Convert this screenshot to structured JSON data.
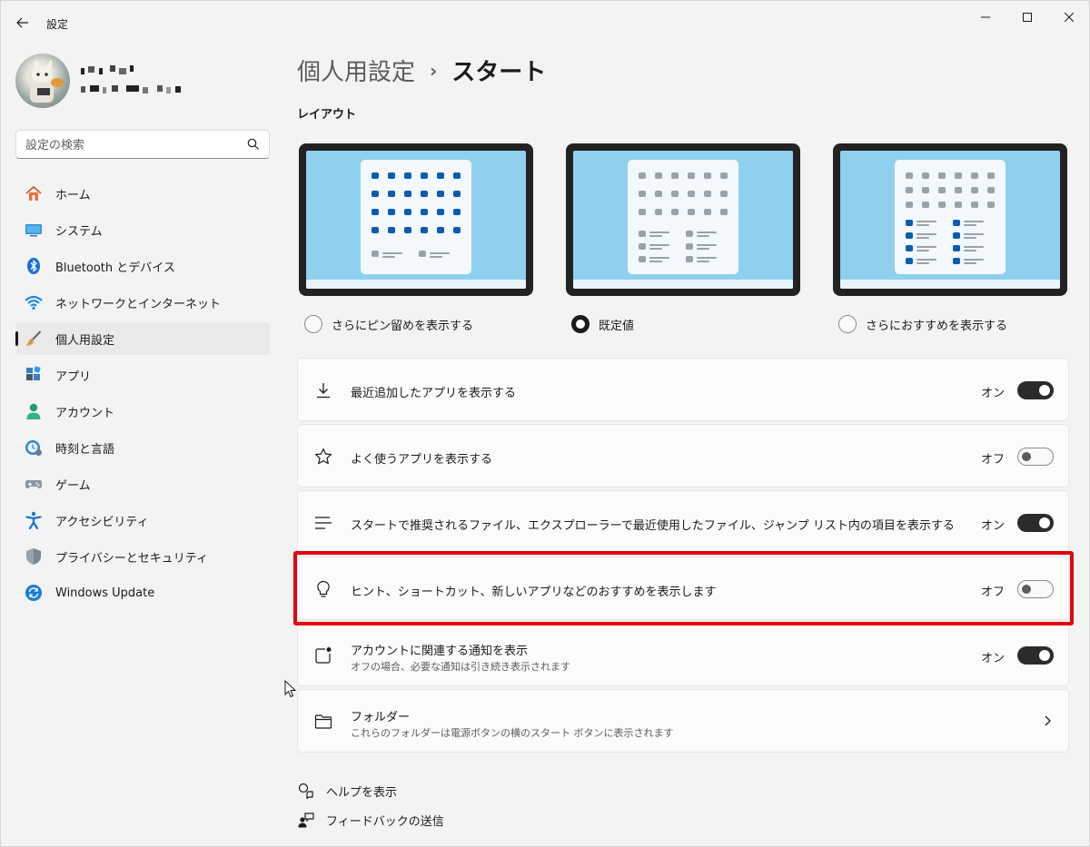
{
  "app": {
    "title": "設定"
  },
  "profile": {
    "name": "",
    "email": ""
  },
  "search": {
    "placeholder": "設定の検索"
  },
  "sidebar": {
    "items": [
      {
        "label": "ホーム",
        "icon": "home-icon"
      },
      {
        "label": "システム",
        "icon": "system-icon"
      },
      {
        "label": "Bluetooth とデバイス",
        "icon": "bluetooth-icon"
      },
      {
        "label": "ネットワークとインターネット",
        "icon": "wifi-icon"
      },
      {
        "label": "個人用設定",
        "icon": "brush-icon",
        "active": true
      },
      {
        "label": "アプリ",
        "icon": "apps-icon"
      },
      {
        "label": "アカウント",
        "icon": "account-icon"
      },
      {
        "label": "時刻と言語",
        "icon": "clock-globe-icon"
      },
      {
        "label": "ゲーム",
        "icon": "gamepad-icon"
      },
      {
        "label": "アクセシビリティ",
        "icon": "accessibility-icon"
      },
      {
        "label": "プライバシーとセキュリティ",
        "icon": "shield-icon"
      },
      {
        "label": "Windows Update",
        "icon": "update-icon"
      }
    ]
  },
  "breadcrumb": {
    "parent": "個人用設定",
    "separator": "›",
    "current": "スタート"
  },
  "layout_section": {
    "title": "レイアウト",
    "options": [
      {
        "label": "さらにピン留めを表示する",
        "selected": false
      },
      {
        "label": "既定値",
        "selected": true
      },
      {
        "label": "さらにおすすめを表示する",
        "selected": false
      }
    ]
  },
  "settings": [
    {
      "title": "最近追加したアプリを表示する",
      "state": "オン",
      "on": true,
      "icon": "download-icon"
    },
    {
      "title": "よく使うアプリを表示する",
      "state": "オフ",
      "on": false,
      "icon": "star-icon"
    },
    {
      "title": "スタートで推奨されるファイル、エクスプローラーで最近使用したファイル、ジャンプ リスト内の項目を表示する",
      "state": "オン",
      "on": true,
      "icon": "list-icon"
    },
    {
      "title": "ヒント、ショートカット、新しいアプリなどのおすすめを表示します",
      "state": "オフ",
      "on": false,
      "icon": "lightbulb-icon"
    },
    {
      "title": "アカウントに関連する通知を表示",
      "subtitle": "オフの場合、必要な通知は引き続き表示されます",
      "state": "オン",
      "on": true,
      "icon": "notification-icon"
    },
    {
      "title": "フォルダー",
      "subtitle": "これらのフォルダーは電源ボタンの横のスタート ボタンに表示されます",
      "icon": "folder-icon"
    }
  ],
  "footer": {
    "help": "ヘルプを表示",
    "feedback": "フィードバックの送信"
  },
  "colors": {
    "accent": "#1b1b1b",
    "highlight": "#e3000f",
    "layout_sky": "#8ed0ee",
    "pin_blue": "#0a5cb0"
  }
}
